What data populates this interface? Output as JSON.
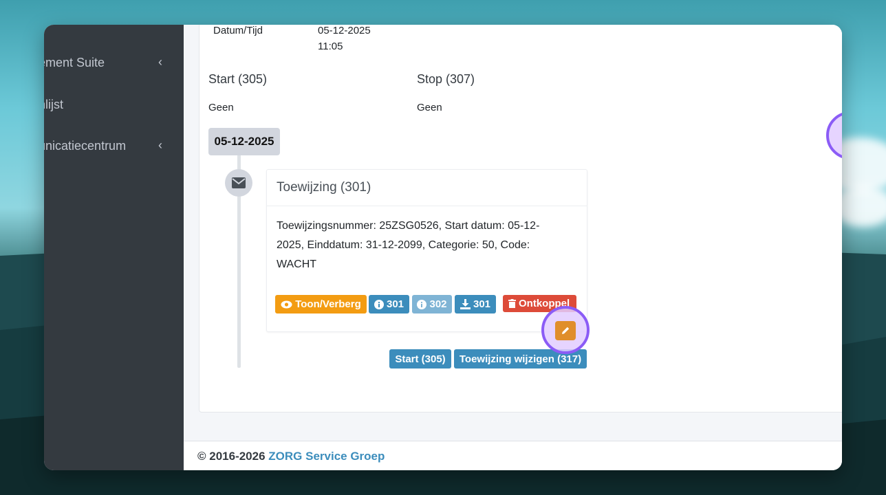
{
  "sidebar": {
    "items": [
      {
        "label": "ement Suite",
        "has_chevron": true
      },
      {
        "label": "nlijst",
        "has_chevron": false
      },
      {
        "label": "unicatiecentrum",
        "has_chevron": true
      }
    ],
    "chevron_glyph": "‹"
  },
  "details": {
    "datetime_label": "Datum/Tijd",
    "datetime_date": "05-12-2025",
    "datetime_time": "11:05",
    "start_label": "Start (305)",
    "start_value": "Geen",
    "stop_label": "Stop (307)",
    "stop_value": "Geen"
  },
  "timeline": {
    "date_label": "05-12-2025",
    "item": {
      "icon": "envelope-icon",
      "title": "Toewijzing (301)",
      "body_line1": "Toewijzingsnummer: 25ZSG0526, Start datum: 05-12-",
      "body_line2": "2025, Einddatum: 31-12-2099, Categorie: 50, Code:",
      "body_line3": "WACHT",
      "buttons": {
        "toggle": "Toon/Verberg",
        "info1": "301",
        "info2": "302",
        "download": "301",
        "unlink": "Ontkoppel"
      }
    },
    "actions": {
      "start": "Start (305)",
      "change": "Toewijzing wijzigen (317)"
    }
  },
  "footer": {
    "copyright": "© 2016-2026 ",
    "company": "ZORG Service Groep"
  },
  "colors": {
    "sidebar_bg": "#343a40",
    "warning": "#f39c12",
    "info": "#3c8dbc",
    "danger": "#dd4b39",
    "highlight": "#8b5cf6"
  }
}
